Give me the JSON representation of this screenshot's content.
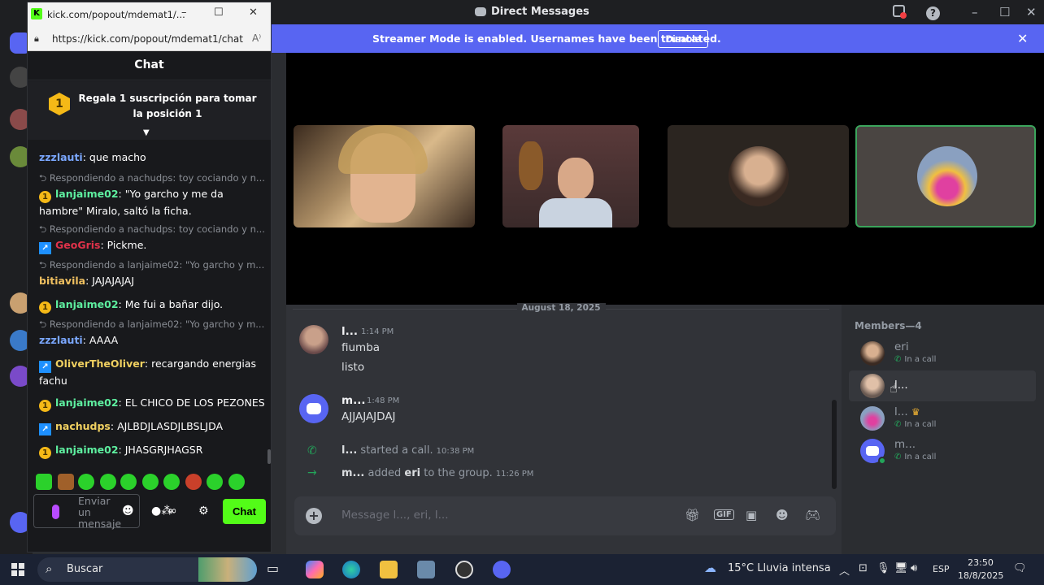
{
  "discord": {
    "window_title": "Direct Messages",
    "banner": {
      "message": "Streamer Mode is enabled. Usernames have been truncated.",
      "disable_label": "Disable"
    },
    "date_separator": "August 18, 2025",
    "messages": [
      {
        "author": "l...",
        "time": "1:14 PM",
        "lines": [
          "fiumba",
          "listo"
        ]
      },
      {
        "author": "m...",
        "time": "1:48 PM",
        "lines": [
          "AJJAJAJDAJ"
        ]
      }
    ],
    "system_messages": [
      {
        "actor": "l...",
        "text": "started a call.",
        "time": "10:38 PM"
      },
      {
        "actor": "m...",
        "text": "added",
        "target": "eri",
        "text2": "to the group.",
        "time": "11:26 PM"
      }
    ],
    "composer_placeholder": "Message l..., eri, l...",
    "members_title": "Members—4",
    "members": [
      {
        "name": "eri",
        "status": "In a call"
      },
      {
        "name": "l...",
        "status": ""
      },
      {
        "name": "l...",
        "status": "In a call",
        "crown": "♛"
      },
      {
        "name": "m...",
        "status": "In a call"
      }
    ],
    "icons": {
      "inbox": "inbox-icon",
      "help": "help-icon"
    },
    "colors": {
      "blurple": "#5865f2",
      "call_green": "#23a55a"
    }
  },
  "kick": {
    "window_title": "kick.com/popout/mdemat1/...",
    "url": "https://kick.com/popout/mdemat1/chat",
    "chat_header": "Chat",
    "promo": {
      "rank": "1",
      "text": "Regala 1 suscripción para tomar la posición 1"
    },
    "chat": [
      {
        "type": "msg",
        "badge": "",
        "user": "zzzlauti",
        "user_color": "#7aa7ff",
        "text": "que macho"
      },
      {
        "type": "reply",
        "text": "Respondiendo a nachudps: toy cociando y n..."
      },
      {
        "type": "msg",
        "badge": "gold",
        "user": "lanjaime02",
        "user_color": "#5ef0a0",
        "text": "\"Yo garcho y me da hambre\" Miralo, saltó la ficha."
      },
      {
        "type": "reply",
        "text": "Respondiendo a nachudps: toy cociando y n..."
      },
      {
        "type": "msg",
        "badge": "blue",
        "user": "GeoGris",
        "user_color": "#e0324a",
        "text": "Pickme."
      },
      {
        "type": "reply",
        "text": "Respondiendo a lanjaime02: \"Yo garcho y m..."
      },
      {
        "type": "msg",
        "badge": "",
        "user": "bitiavila",
        "user_color": "#f0c060",
        "text": "JAJAJAJAJ"
      },
      {
        "type": "msg",
        "badge": "gold",
        "user": "lanjaime02",
        "user_color": "#5ef0a0",
        "text": "Me fui a bañar dijo."
      },
      {
        "type": "reply",
        "text": "Respondiendo a lanjaime02: \"Yo garcho y m..."
      },
      {
        "type": "msg",
        "badge": "",
        "user": "zzzlauti",
        "user_color": "#7aa7ff",
        "text": "AAAA"
      },
      {
        "type": "msg",
        "badge": "blue",
        "user": "OliverTheOliver",
        "user_color": "#f0d060",
        "text": "recargando energias fachu"
      },
      {
        "type": "msg",
        "badge": "gold",
        "user": "lanjaime02",
        "user_color": "#5ef0a0",
        "text": "EL CHICO DE LOS PEZONES"
      },
      {
        "type": "msg",
        "badge": "blue",
        "user": "nachudps",
        "user_color": "#f0d060",
        "text": "AJLBDJLASDJLBSLJDA"
      },
      {
        "type": "msg",
        "badge": "gold",
        "user": "lanjaime02",
        "user_color": "#5ef0a0",
        "text": "JHASGRJHAGSR"
      }
    ],
    "input_placeholder": "Enviar un mensaje",
    "chat_button": "Chat",
    "colors": {
      "kick_green": "#53fc18"
    }
  },
  "taskbar": {
    "search_label": "Buscar",
    "weather": "15°C  Lluvia intensa",
    "language": "ESP",
    "time": "23:50",
    "date": "18/8/2025"
  }
}
